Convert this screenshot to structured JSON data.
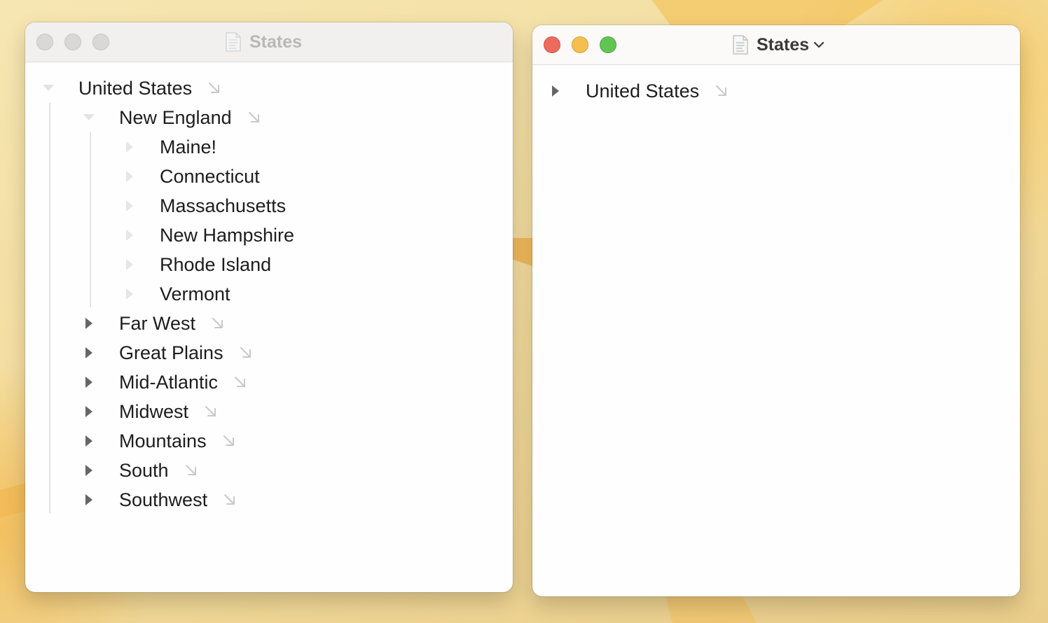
{
  "left_window": {
    "title": "States",
    "state": "inactive",
    "outline": [
      {
        "label": "United States",
        "level": 0,
        "expanded": true,
        "disclosure": "expanded",
        "link": true
      },
      {
        "label": "New England",
        "level": 1,
        "expanded": true,
        "disclosure": "expanded",
        "link": true
      },
      {
        "label": "Maine!",
        "level": 2,
        "disclosure": "empty",
        "link": false
      },
      {
        "label": "Connecticut",
        "level": 2,
        "disclosure": "empty",
        "link": false
      },
      {
        "label": "Massachusetts",
        "level": 2,
        "disclosure": "empty",
        "link": false
      },
      {
        "label": "New Hampshire",
        "level": 2,
        "disclosure": "empty",
        "link": false
      },
      {
        "label": "Rhode Island",
        "level": 2,
        "disclosure": "empty",
        "link": false
      },
      {
        "label": "Vermont",
        "level": 2,
        "disclosure": "empty",
        "link": false
      },
      {
        "label": "Far West",
        "level": 1,
        "disclosure": "collapsed",
        "link": true
      },
      {
        "label": "Great Plains",
        "level": 1,
        "disclosure": "collapsed",
        "link": true
      },
      {
        "label": "Mid-Atlantic",
        "level": 1,
        "disclosure": "collapsed",
        "link": true
      },
      {
        "label": "Midwest",
        "level": 1,
        "disclosure": "collapsed",
        "link": true
      },
      {
        "label": "Mountains",
        "level": 1,
        "disclosure": "collapsed",
        "link": true
      },
      {
        "label": "South",
        "level": 1,
        "disclosure": "collapsed",
        "link": true
      },
      {
        "label": "Southwest",
        "level": 1,
        "disclosure": "collapsed",
        "link": true
      }
    ]
  },
  "right_window": {
    "title": "States",
    "state": "active",
    "outline": [
      {
        "label": "United States",
        "level": 0,
        "disclosure": "collapsed",
        "link": true
      }
    ]
  },
  "colors": {
    "close": "#ec6a5e",
    "minimize": "#f4bf4f",
    "zoom": "#61c554",
    "inactive_light": "#d9d8d7"
  }
}
